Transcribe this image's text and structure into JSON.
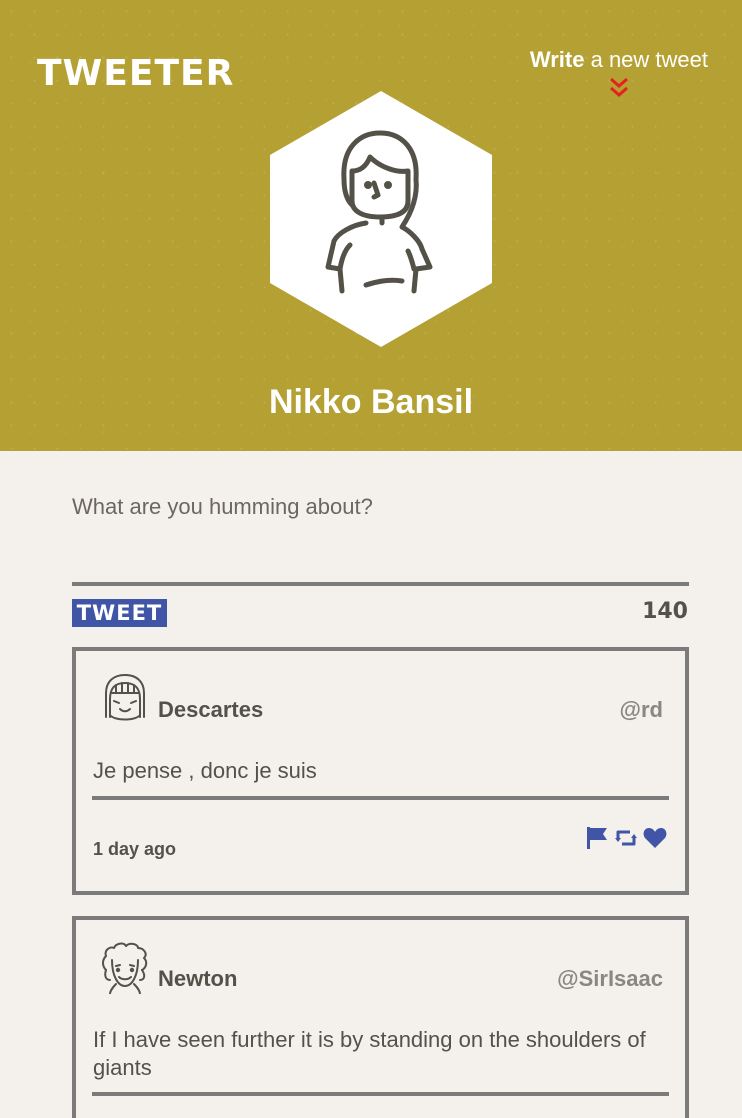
{
  "header": {
    "brand": "TWEETER",
    "compose_link": {
      "bold": "Write",
      "rest": "a new tweet"
    },
    "profile_name": "Nikko Bansil"
  },
  "composer": {
    "placeholder": "What are you humming about?",
    "value": "",
    "button_label": "TWEET",
    "char_count": "140"
  },
  "tweets": [
    {
      "name": "Descartes",
      "handle": "@rd",
      "text": "Je pense , donc je suis",
      "time": "1 day ago",
      "actions": [
        "flag-icon",
        "retweet-icon",
        "heart-icon"
      ]
    },
    {
      "name": "Newton",
      "handle": "@SirIsaac",
      "text": "If I have seen further it is by standing on the shoulders of giants"
    }
  ],
  "colors": {
    "header_bg": "#b4a033",
    "page_bg": "#f4f1ed",
    "accent_blue": "#4055a6",
    "accent_red": "#e3221b",
    "text_dark": "#545149",
    "rule_gray": "#7b7b7b"
  }
}
